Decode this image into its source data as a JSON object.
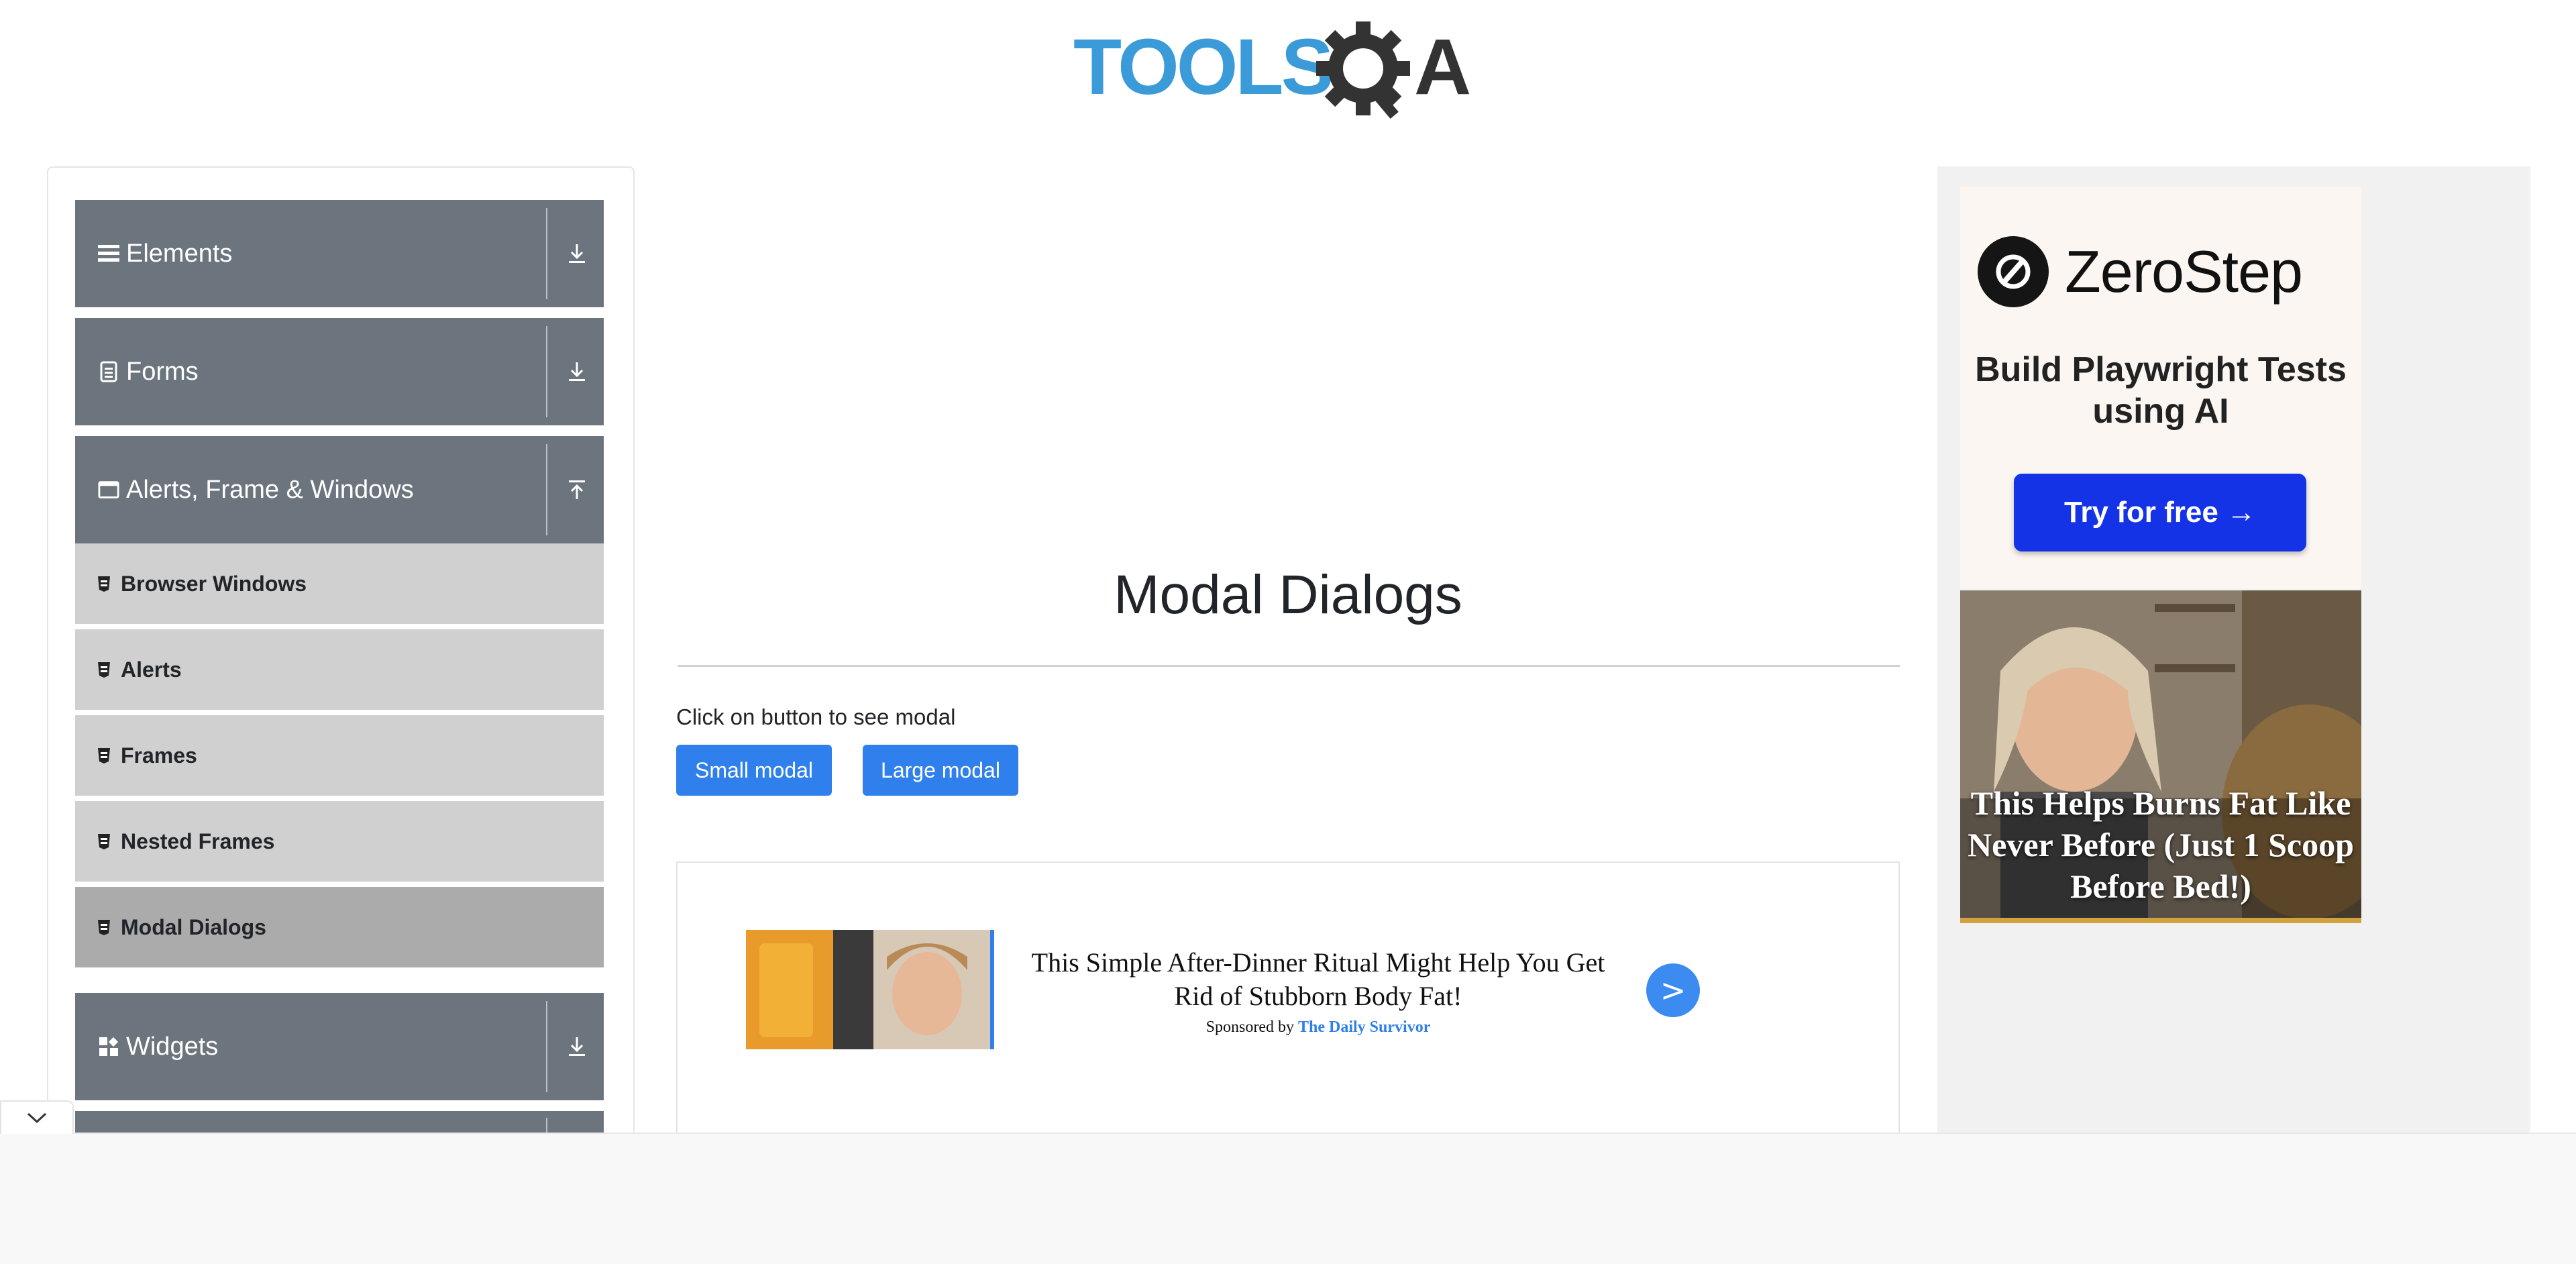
{
  "header": {
    "logo_text": "TOOLSQA"
  },
  "sidebar": {
    "groups": [
      {
        "label": "Elements",
        "icon": "menu-icon",
        "expanded": false
      },
      {
        "label": "Forms",
        "icon": "document-icon",
        "expanded": false
      },
      {
        "label": "Alerts, Frame & Windows",
        "icon": "window-icon",
        "expanded": true
      },
      {
        "label": "Widgets",
        "icon": "widgets-icon",
        "expanded": false
      }
    ],
    "items": [
      {
        "label": "Browser Windows",
        "icon": "badge-icon"
      },
      {
        "label": "Alerts",
        "icon": "badge-icon"
      },
      {
        "label": "Frames",
        "icon": "badge-icon"
      },
      {
        "label": "Nested Frames",
        "icon": "badge-icon"
      },
      {
        "label": "Modal Dialogs",
        "icon": "badge-icon",
        "active": true
      }
    ]
  },
  "main": {
    "title": "Modal Dialogs",
    "instruction": "Click on button to see modal",
    "buttons": {
      "small": "Small modal",
      "large": "Large modal"
    }
  },
  "ad_card": {
    "headline": "This Simple After-Dinner Ritual Might Help You Get Rid of Stubborn Body Fat!",
    "sponsored_prefix": "Sponsored by",
    "sponsor": "The Daily Survivor",
    "go_label": ">"
  },
  "right_ad": {
    "brand": "ZeroStep",
    "tagline": "Build Playwright Tests using AI",
    "cta": "Try for free →",
    "promo_text": "This Helps Burns Fat Like Never Before (Just 1 Scoop Before Bed!)"
  },
  "colors": {
    "sidebar_group": "#6c757d",
    "sidebar_item": "#d0d0d0",
    "sidebar_item_active": "#ababab",
    "primary_button": "#2f80ed",
    "cta_blue": "#1533e6"
  }
}
